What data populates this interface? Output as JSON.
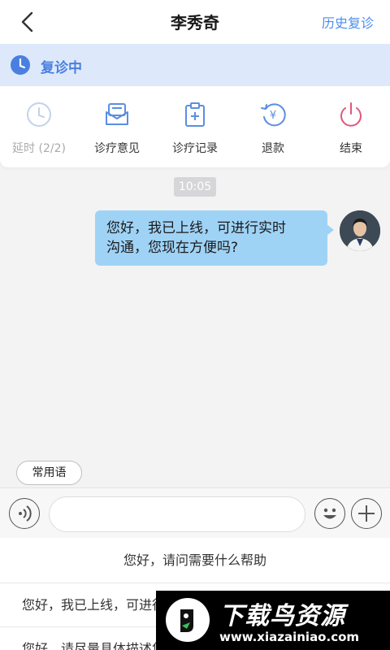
{
  "header": {
    "title": "李秀奇",
    "history_link": "历史复诊"
  },
  "status": {
    "text": "复诊中",
    "accent": "#4a7fe0"
  },
  "actions": [
    {
      "label": "延时 (2/2)",
      "icon": "clock-icon",
      "disabled": true
    },
    {
      "label": "诊疗意见",
      "icon": "envelope-icon"
    },
    {
      "label": "诊疗记录",
      "icon": "clipboard-plus-icon"
    },
    {
      "label": "退款",
      "icon": "refund-yuan-icon"
    },
    {
      "label": "结束",
      "icon": "power-icon"
    }
  ],
  "chat": {
    "timestamp": "10:05",
    "message": {
      "line1": "您好，我已上线，可进行实时",
      "line2": "沟通，您现在方便吗?"
    }
  },
  "composer": {
    "quick_phrase_button": "常用语",
    "input_value": ""
  },
  "phrases": {
    "header": "您好，请问需要什么帮助",
    "items": [
      "您好，我已上线，可进行实时沟通，您现在方便吗?",
      "您好，请尽量具体描述您的症状，以便帮您诊断"
    ]
  },
  "watermark": {
    "title": "下载鸟资源",
    "url": "www.xiazainiao.com"
  }
}
